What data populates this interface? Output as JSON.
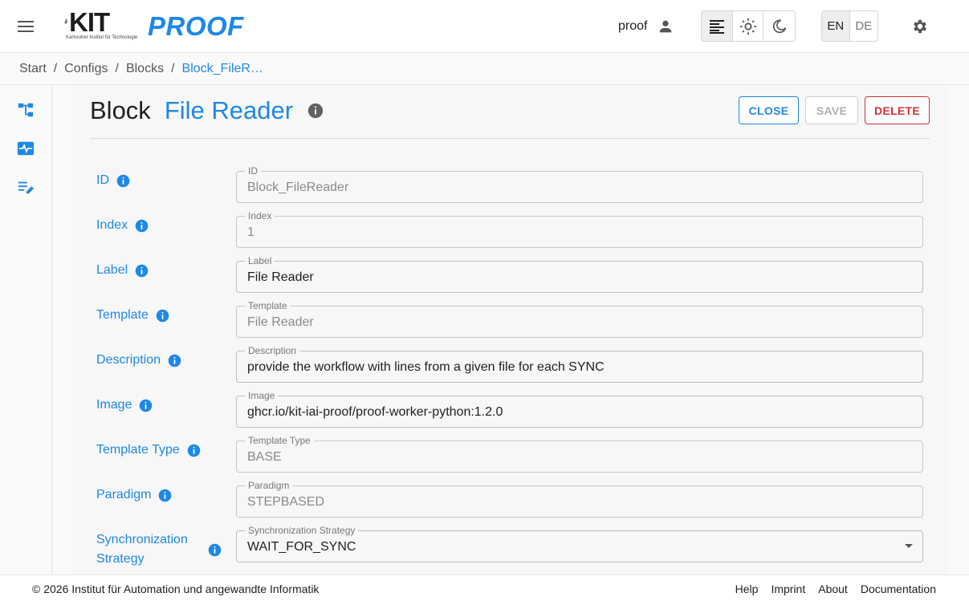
{
  "header": {
    "kit_logo_text": "KIT",
    "kit_logo_subtitle": "Karlsruher Institut für Technologie",
    "app_name": "PROOF",
    "user_name": "proof",
    "lang_active": "EN",
    "lang_inactive": "DE"
  },
  "breadcrumb": [
    "Start",
    "Configs",
    "Blocks",
    "Block_FileR…"
  ],
  "breadcrumb_sep": "/",
  "page": {
    "title_prefix": "Block",
    "title_name": "File Reader",
    "close_label": "CLOSE",
    "save_label": "SAVE",
    "delete_label": "DELETE"
  },
  "fields": [
    {
      "label": "ID",
      "field_label": "ID",
      "value": "Block_FileReader",
      "editable": false
    },
    {
      "label": "Index",
      "field_label": "Index",
      "value": "1",
      "editable": false
    },
    {
      "label": "Label",
      "field_label": "Label",
      "value": "File Reader",
      "editable": true
    },
    {
      "label": "Template",
      "field_label": "Template",
      "value": "File Reader",
      "editable": false
    },
    {
      "label": "Description",
      "field_label": "Description",
      "value": "provide the workflow with lines from a given file for each SYNC",
      "editable": true
    },
    {
      "label": "Image",
      "field_label": "Image",
      "value": "ghcr.io/kit-iai-proof/proof-worker-python:1.2.0",
      "editable": true
    },
    {
      "label": "Template Type",
      "field_label": "Template Type",
      "value": "BASE",
      "editable": false
    },
    {
      "label": "Paradigm",
      "field_label": "Paradigm",
      "value": "STEPBASED",
      "editable": false
    },
    {
      "label_line1": "Synchronization",
      "label_line2": "Strategy",
      "field_label": "Synchronization Strategy",
      "value": "WAIT_FOR_SYNC",
      "editable": true
    }
  ],
  "footer": {
    "copyright": "© 2026 Institut für Automation und angewandte Informatik",
    "links": [
      "Help",
      "Imprint",
      "About",
      "Documentation"
    ]
  },
  "colors": {
    "accent": "#1e88e5",
    "danger": "#d32f2f"
  }
}
